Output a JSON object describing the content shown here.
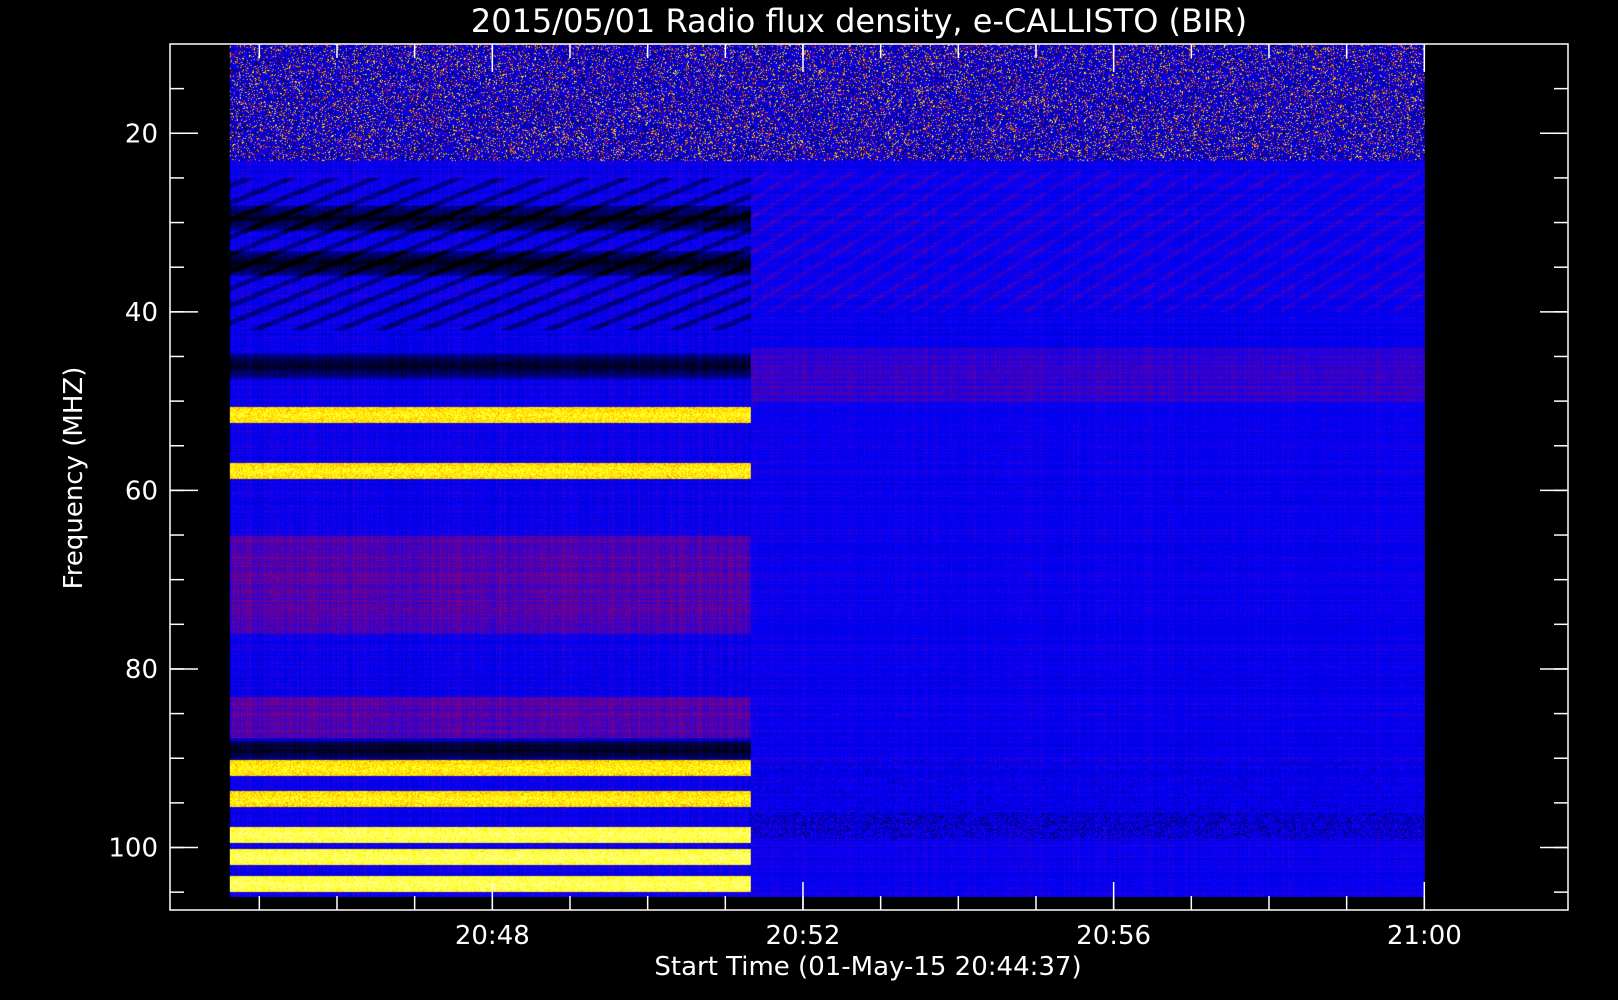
{
  "chart_data": {
    "type": "heatmap",
    "title": "2015/05/01  Radio flux density, e-CALLISTO (BIR)",
    "xlabel": "Start Time (01-May-15 20:44:37)",
    "ylabel": "Frequency (MHZ)",
    "x_ticks": [
      "20:48",
      "20:52",
      "20:56",
      "21:00"
    ],
    "x_tick_values_min": [
      48,
      52,
      56,
      60
    ],
    "x_minor_tick_values_min": [
      45,
      46,
      47,
      48,
      49,
      50,
      51,
      52,
      53,
      54,
      55,
      56,
      57,
      58,
      59,
      60
    ],
    "y_ticks": [
      "20",
      "40",
      "60",
      "80",
      "100"
    ],
    "y_tick_values": [
      20,
      40,
      60,
      80,
      100
    ],
    "y_minor_tick_values": [
      15,
      20,
      25,
      30,
      35,
      40,
      45,
      50,
      55,
      60,
      65,
      70,
      75,
      80,
      85,
      90,
      95,
      100,
      105
    ],
    "x_range_min": [
      44.62,
      60
    ],
    "x_axis_range_min": [
      43.85,
      61.85
    ],
    "y_range_mhz": [
      10,
      105.5
    ],
    "y_axis_range_mhz": [
      10,
      107
    ],
    "y_inverted": true,
    "colormap": [
      "#000000",
      "#0000ff",
      "#ff0000",
      "#ffff00",
      "#ffffff"
    ],
    "switch_time_min": 51.33,
    "bright_bands_before_switch_mhz": [
      51.5,
      57.8,
      91,
      94.5,
      98.5,
      101,
      104
    ],
    "dark_bands_before_switch_mhz": [
      29.5,
      34.5,
      46,
      89
    ],
    "rfi_band_range_mhz": [
      11,
      23
    ],
    "grid": false
  }
}
